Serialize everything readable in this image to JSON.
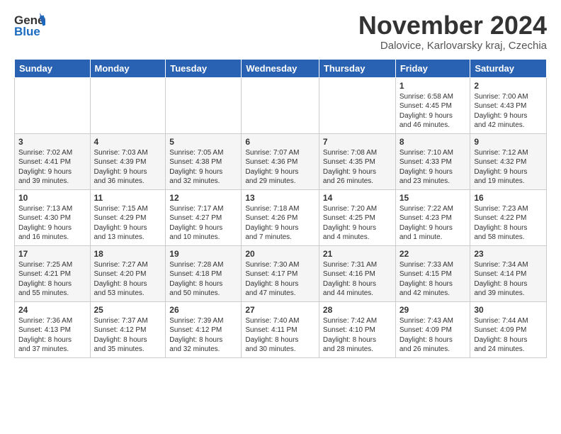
{
  "logo": {
    "general": "General",
    "blue": "Blue"
  },
  "title": "November 2024",
  "location": "Dalovice, Karlovarsky kraj, Czechia",
  "weekdays": [
    "Sunday",
    "Monday",
    "Tuesday",
    "Wednesday",
    "Thursday",
    "Friday",
    "Saturday"
  ],
  "weeks": [
    [
      {
        "day": "",
        "info": ""
      },
      {
        "day": "",
        "info": ""
      },
      {
        "day": "",
        "info": ""
      },
      {
        "day": "",
        "info": ""
      },
      {
        "day": "",
        "info": ""
      },
      {
        "day": "1",
        "info": "Sunrise: 6:58 AM\nSunset: 4:45 PM\nDaylight: 9 hours\nand 46 minutes."
      },
      {
        "day": "2",
        "info": "Sunrise: 7:00 AM\nSunset: 4:43 PM\nDaylight: 9 hours\nand 42 minutes."
      }
    ],
    [
      {
        "day": "3",
        "info": "Sunrise: 7:02 AM\nSunset: 4:41 PM\nDaylight: 9 hours\nand 39 minutes."
      },
      {
        "day": "4",
        "info": "Sunrise: 7:03 AM\nSunset: 4:39 PM\nDaylight: 9 hours\nand 36 minutes."
      },
      {
        "day": "5",
        "info": "Sunrise: 7:05 AM\nSunset: 4:38 PM\nDaylight: 9 hours\nand 32 minutes."
      },
      {
        "day": "6",
        "info": "Sunrise: 7:07 AM\nSunset: 4:36 PM\nDaylight: 9 hours\nand 29 minutes."
      },
      {
        "day": "7",
        "info": "Sunrise: 7:08 AM\nSunset: 4:35 PM\nDaylight: 9 hours\nand 26 minutes."
      },
      {
        "day": "8",
        "info": "Sunrise: 7:10 AM\nSunset: 4:33 PM\nDaylight: 9 hours\nand 23 minutes."
      },
      {
        "day": "9",
        "info": "Sunrise: 7:12 AM\nSunset: 4:32 PM\nDaylight: 9 hours\nand 19 minutes."
      }
    ],
    [
      {
        "day": "10",
        "info": "Sunrise: 7:13 AM\nSunset: 4:30 PM\nDaylight: 9 hours\nand 16 minutes."
      },
      {
        "day": "11",
        "info": "Sunrise: 7:15 AM\nSunset: 4:29 PM\nDaylight: 9 hours\nand 13 minutes."
      },
      {
        "day": "12",
        "info": "Sunrise: 7:17 AM\nSunset: 4:27 PM\nDaylight: 9 hours\nand 10 minutes."
      },
      {
        "day": "13",
        "info": "Sunrise: 7:18 AM\nSunset: 4:26 PM\nDaylight: 9 hours\nand 7 minutes."
      },
      {
        "day": "14",
        "info": "Sunrise: 7:20 AM\nSunset: 4:25 PM\nDaylight: 9 hours\nand 4 minutes."
      },
      {
        "day": "15",
        "info": "Sunrise: 7:22 AM\nSunset: 4:23 PM\nDaylight: 9 hours\nand 1 minute."
      },
      {
        "day": "16",
        "info": "Sunrise: 7:23 AM\nSunset: 4:22 PM\nDaylight: 8 hours\nand 58 minutes."
      }
    ],
    [
      {
        "day": "17",
        "info": "Sunrise: 7:25 AM\nSunset: 4:21 PM\nDaylight: 8 hours\nand 55 minutes."
      },
      {
        "day": "18",
        "info": "Sunrise: 7:27 AM\nSunset: 4:20 PM\nDaylight: 8 hours\nand 53 minutes."
      },
      {
        "day": "19",
        "info": "Sunrise: 7:28 AM\nSunset: 4:18 PM\nDaylight: 8 hours\nand 50 minutes."
      },
      {
        "day": "20",
        "info": "Sunrise: 7:30 AM\nSunset: 4:17 PM\nDaylight: 8 hours\nand 47 minutes."
      },
      {
        "day": "21",
        "info": "Sunrise: 7:31 AM\nSunset: 4:16 PM\nDaylight: 8 hours\nand 44 minutes."
      },
      {
        "day": "22",
        "info": "Sunrise: 7:33 AM\nSunset: 4:15 PM\nDaylight: 8 hours\nand 42 minutes."
      },
      {
        "day": "23",
        "info": "Sunrise: 7:34 AM\nSunset: 4:14 PM\nDaylight: 8 hours\nand 39 minutes."
      }
    ],
    [
      {
        "day": "24",
        "info": "Sunrise: 7:36 AM\nSunset: 4:13 PM\nDaylight: 8 hours\nand 37 minutes."
      },
      {
        "day": "25",
        "info": "Sunrise: 7:37 AM\nSunset: 4:12 PM\nDaylight: 8 hours\nand 35 minutes."
      },
      {
        "day": "26",
        "info": "Sunrise: 7:39 AM\nSunset: 4:12 PM\nDaylight: 8 hours\nand 32 minutes."
      },
      {
        "day": "27",
        "info": "Sunrise: 7:40 AM\nSunset: 4:11 PM\nDaylight: 8 hours\nand 30 minutes."
      },
      {
        "day": "28",
        "info": "Sunrise: 7:42 AM\nSunset: 4:10 PM\nDaylight: 8 hours\nand 28 minutes."
      },
      {
        "day": "29",
        "info": "Sunrise: 7:43 AM\nSunset: 4:09 PM\nDaylight: 8 hours\nand 26 minutes."
      },
      {
        "day": "30",
        "info": "Sunrise: 7:44 AM\nSunset: 4:09 PM\nDaylight: 8 hours\nand 24 minutes."
      }
    ]
  ]
}
